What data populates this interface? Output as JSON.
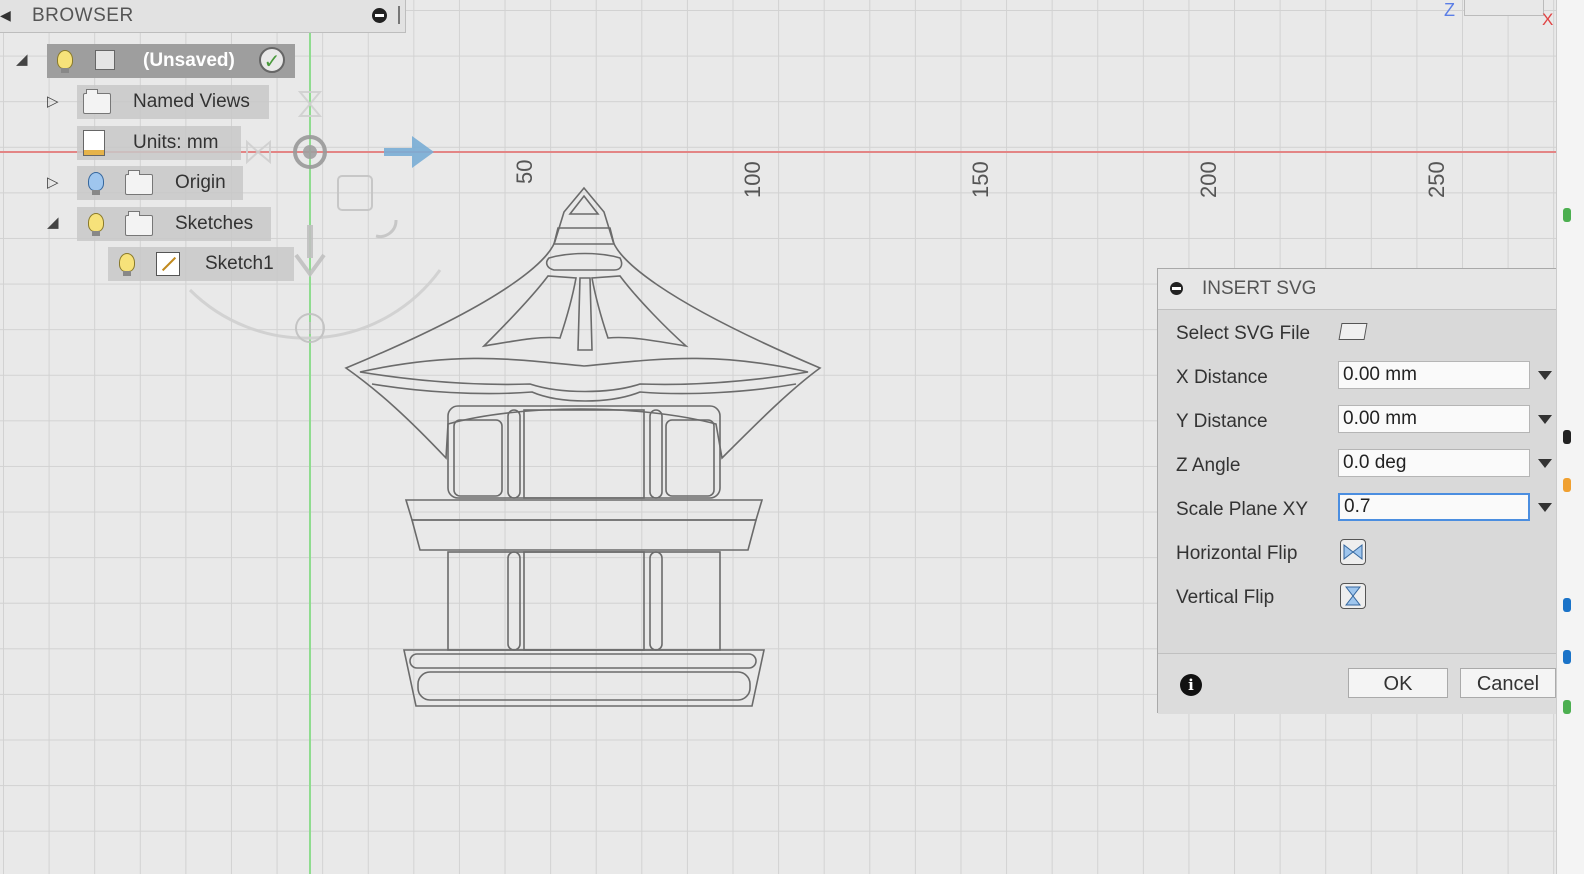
{
  "browser": {
    "title": "BROWSER",
    "items": [
      {
        "label": "(Unsaved)"
      },
      {
        "label": "Named Views"
      },
      {
        "label": "Units: mm"
      },
      {
        "label": "Origin"
      },
      {
        "label": "Sketches"
      },
      {
        "label": "Sketch1"
      }
    ]
  },
  "ruler": {
    "labels": [
      "50",
      "100",
      "150",
      "200",
      "250"
    ]
  },
  "viewcube": {
    "axis_z": "Z",
    "axis_x": "X"
  },
  "dialog": {
    "title": "INSERT SVG",
    "rows": {
      "select_file": {
        "label": "Select SVG File"
      },
      "x_distance": {
        "label": "X Distance",
        "value": "0.00 mm"
      },
      "y_distance": {
        "label": "Y Distance",
        "value": "0.00 mm"
      },
      "z_angle": {
        "label": "Z Angle",
        "value": "0.0 deg"
      },
      "scale": {
        "label": "Scale Plane XY",
        "value": "0.7"
      },
      "h_flip": {
        "label": "Horizontal Flip"
      },
      "v_flip": {
        "label": "Vertical Flip"
      }
    },
    "ok_label": "OK",
    "cancel_label": "Cancel"
  },
  "colors": {
    "x_axis": "#e38585",
    "y_axis": "#8fdc8f",
    "highlight": "#4b8ee0",
    "arrow": "#7aaed6"
  }
}
